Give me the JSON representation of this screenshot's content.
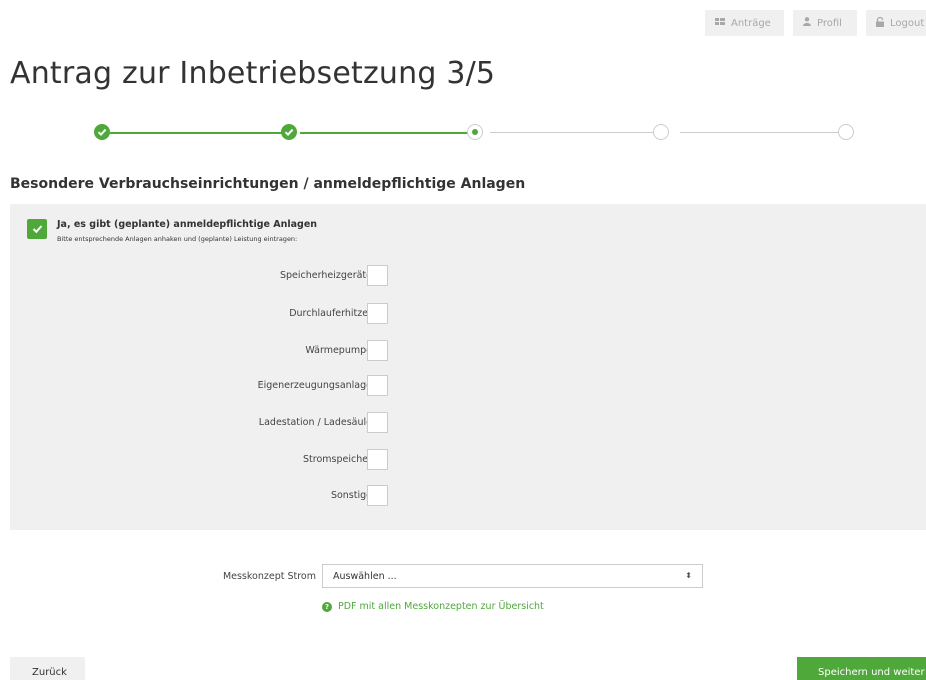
{
  "nav": {
    "antraege_label": "Anträge",
    "profil_label": "Profil",
    "logout_label": "Logout"
  },
  "page_title": "Antrag zur Inbetriebsetzung 3/5",
  "stepper": {
    "steps": [
      "done",
      "done",
      "current",
      "todo",
      "todo"
    ]
  },
  "section_title": "Besondere Verbrauchseinrichtungen / anmeldepflichtige Anlagen",
  "main_check": {
    "checked": true,
    "label": "Ja, es gibt (geplante) anmeldepflichtige Anlagen",
    "hint": "Bitte entsprechende Anlagen anhaken und (geplante) Leistung eintragen:"
  },
  "options": [
    {
      "label": "Speicherheizgeräte",
      "checked": false
    },
    {
      "label": "Durchlauferhitzer",
      "checked": false
    },
    {
      "label": "Wärmepumpe",
      "checked": false
    },
    {
      "label": "Eigenerzeugungsanlage",
      "checked": false
    },
    {
      "label": "Ladestation / Ladesäule",
      "checked": false
    },
    {
      "label": "Stromspeicher",
      "checked": false
    },
    {
      "label": "Sonstige",
      "checked": false
    }
  ],
  "messkonzept": {
    "label": "Messkonzept Strom",
    "selected": "Auswählen ...",
    "arrow": "⬍",
    "pdf_link": "PDF mit allen Messkonzepten zur Übersicht"
  },
  "buttons": {
    "back": "Zurück",
    "save": "Speichern und weiter"
  },
  "colors": {
    "accent": "#4fa83a",
    "panel": "#f0f0f0"
  }
}
